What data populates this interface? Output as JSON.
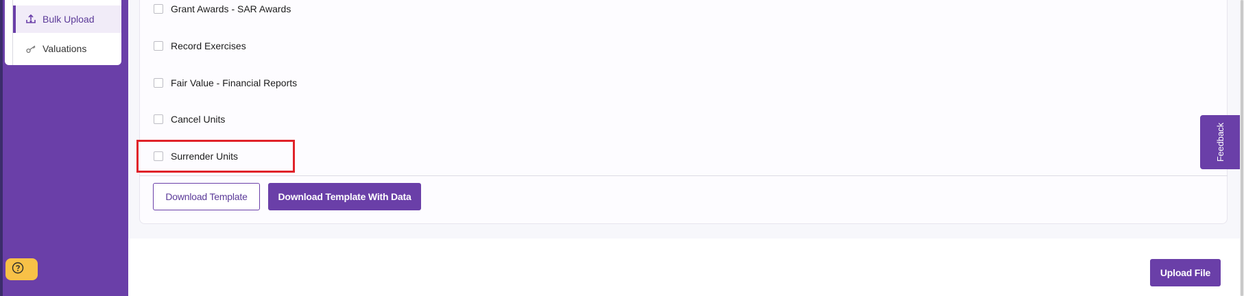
{
  "sidebar": {
    "items": [
      {
        "label": "Bulk Upload",
        "icon": "upload-tray-icon",
        "active": true
      },
      {
        "label": "Valuations",
        "icon": "key-icon",
        "active": false
      }
    ],
    "help_icon": "question-circle-icon"
  },
  "options": [
    {
      "label": "Grant Awards - SAR Awards",
      "checked": false
    },
    {
      "label": "Record Exercises",
      "checked": false
    },
    {
      "label": "Fair Value - Financial Reports",
      "checked": false
    },
    {
      "label": "Cancel Units",
      "checked": false
    },
    {
      "label": "Surrender Units",
      "checked": false,
      "highlighted": true
    }
  ],
  "actions": {
    "download_template": "Download Template",
    "download_template_with_data": "Download Template With Data",
    "upload_file": "Upload File"
  },
  "feedback": {
    "label": "Feedback"
  },
  "colors": {
    "primary": "#6a3fa8",
    "highlight": "#e02229",
    "help": "#f8c147"
  }
}
